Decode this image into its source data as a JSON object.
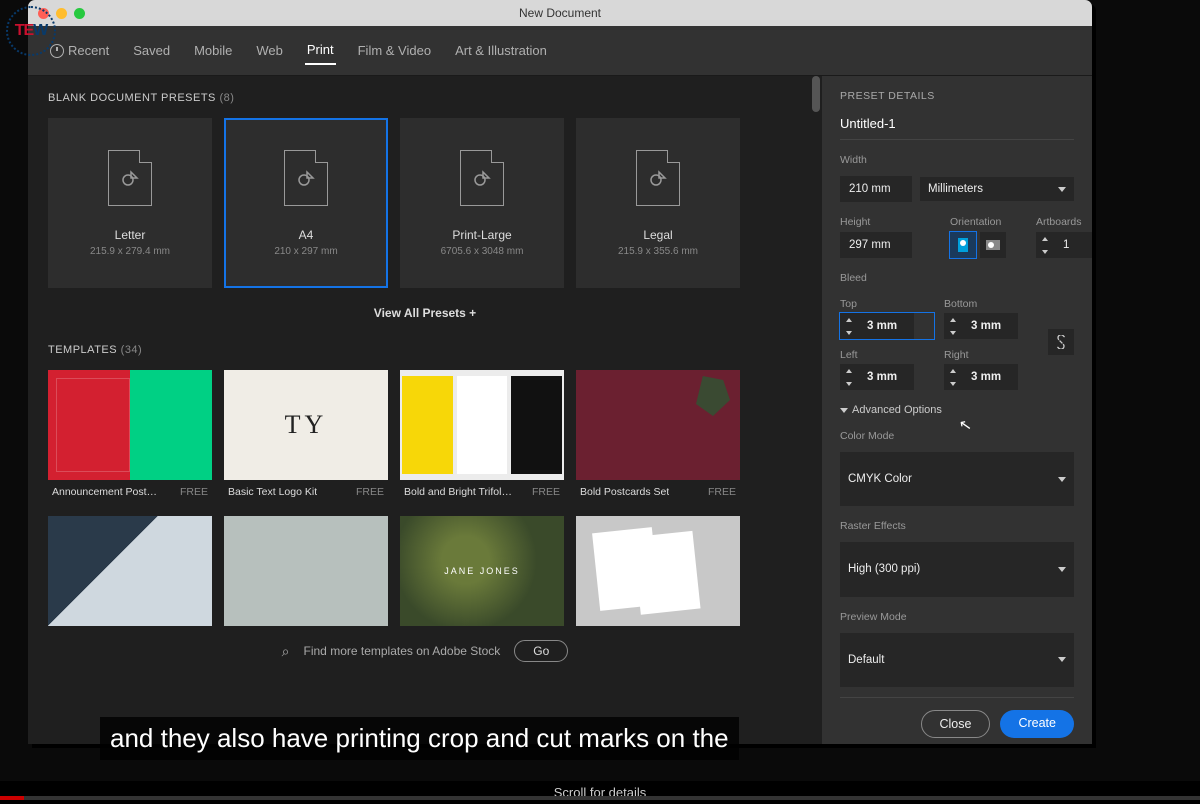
{
  "logo": "TEW",
  "window": {
    "title": "New Document"
  },
  "tabs": [
    "Recent",
    "Saved",
    "Mobile",
    "Web",
    "Print",
    "Film & Video",
    "Art & Illustration"
  ],
  "activeTab": "Print",
  "presets": {
    "title": "BLANK DOCUMENT PRESETS",
    "count": "(8)",
    "items": [
      {
        "name": "Letter",
        "dim": "215.9 x 279.4 mm"
      },
      {
        "name": "A4",
        "dim": "210 x 297 mm"
      },
      {
        "name": "Print-Large",
        "dim": "6705.6 x 3048 mm"
      },
      {
        "name": "Legal",
        "dim": "215.9 x 355.6 mm"
      }
    ],
    "viewAll": "View All Presets +"
  },
  "templates": {
    "title": "TEMPLATES",
    "count": "(34)",
    "items": [
      {
        "name": "Announcement Post…",
        "price": "FREE"
      },
      {
        "name": "Basic Text Logo Kit",
        "price": "FREE"
      },
      {
        "name": "Bold and Bright Trifol…",
        "price": "FREE"
      },
      {
        "name": "Bold Postcards Set",
        "price": "FREE"
      },
      {
        "name": "",
        "price": ""
      },
      {
        "name": "",
        "price": ""
      },
      {
        "name": "",
        "price": ""
      },
      {
        "name": "",
        "price": ""
      }
    ],
    "stockText": "Find more templates on Adobe Stock",
    "goLabel": "Go"
  },
  "details": {
    "heading": "PRESET DETAILS",
    "docName": "Untitled-1",
    "widthLabel": "Width",
    "width": "210 mm",
    "unitsLabel": "Millimeters",
    "heightLabel": "Height",
    "height": "297 mm",
    "orientationLabel": "Orientation",
    "artboardsLabel": "Artboards",
    "artboards": "1",
    "bleedLabel": "Bleed",
    "bleed": {
      "topLabel": "Top",
      "top": "3 mm",
      "bottomLabel": "Bottom",
      "bottom": "3 mm",
      "leftLabel": "Left",
      "left": "3 mm",
      "rightLabel": "Right",
      "right": "3 mm"
    },
    "advancedLabel": "Advanced Options",
    "colorModeLabel": "Color Mode",
    "colorMode": "CMYK Color",
    "rasterLabel": "Raster Effects",
    "raster": "High (300 ppi)",
    "previewLabel": "Preview Mode",
    "preview": "Default",
    "closeLabel": "Close",
    "createLabel": "Create"
  },
  "caption": "and they also have printing crop and cut marks on the",
  "scrollHint": "Scroll for details"
}
